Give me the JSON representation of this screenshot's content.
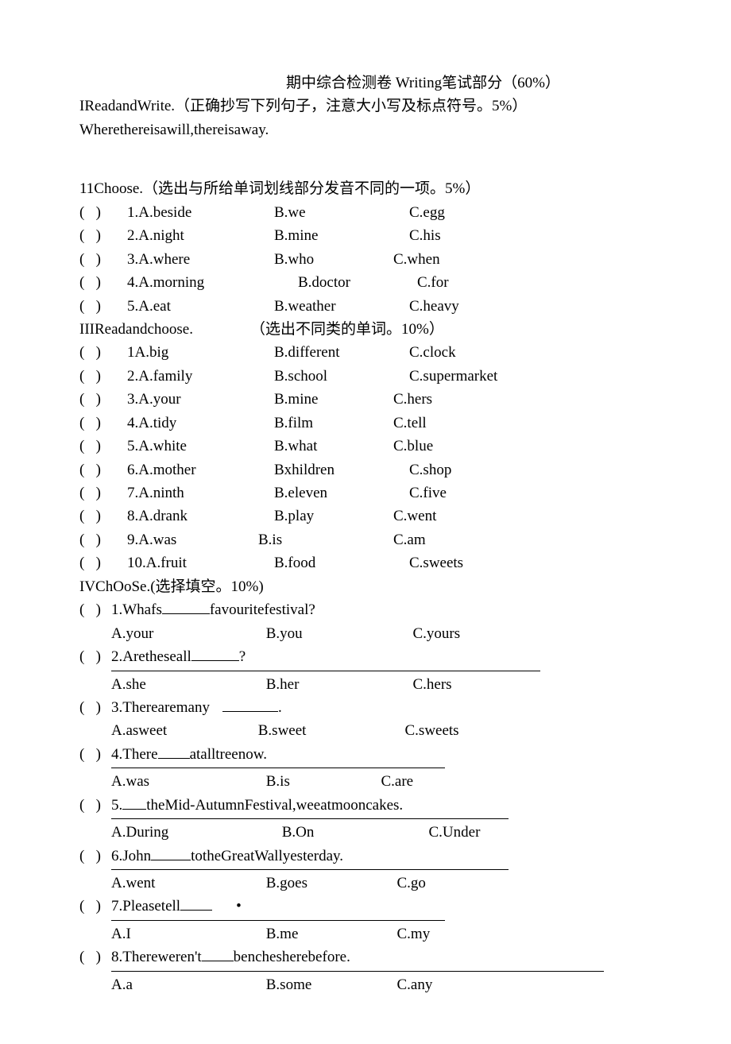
{
  "header": {
    "title": "期中综合检测卷 Writing笔试部分（60%）"
  },
  "section1": {
    "heading": "IReadandWrite.（正确抄写下列句子，注意大小写及标点符号。5%）",
    "sentence": "Wherethereisawill,thereisaway."
  },
  "section2": {
    "heading": "11Choose.（选出与所给单词划线部分发音不同的一项。5%）",
    "q": [
      {
        "n": "1",
        "a": "A.beside",
        "b": "B.we",
        "c": "C.egg"
      },
      {
        "n": "2",
        "a": "A.night",
        "b": "B.mine",
        "c": "C.his"
      },
      {
        "n": "3",
        "a": "A.where",
        "b": "B.who",
        "c": "C.when"
      },
      {
        "n": "4",
        "a": "A.morning",
        "b": "B.doctor",
        "c": "C.for"
      },
      {
        "n": "5",
        "a": "A.eat",
        "b": "B.weather",
        "c": "C.heavy"
      }
    ]
  },
  "section3": {
    "heading_left": "IIIReadandchoose.",
    "heading_right": "（选出不同类的单词。10%）",
    "q": [
      {
        "n": "1",
        "a": "A.big",
        "b": "B.different",
        "c": "C.clock"
      },
      {
        "n": "2",
        "a": "A.family",
        "b": "B.school",
        "c": "C.supermarket"
      },
      {
        "n": "3",
        "a": "A.your",
        "b": "B.mine",
        "c": "C.hers"
      },
      {
        "n": "4",
        "a": "A.tidy",
        "b": "B.film",
        "c": "C.tell"
      },
      {
        "n": "5",
        "a": "A.white",
        "b": "B.what",
        "c": "C.blue"
      },
      {
        "n": "6",
        "a": "A.mother",
        "b": "Bxhildren",
        "c": "C.shop"
      },
      {
        "n": "7",
        "a": "A.ninth",
        "b": "B.eleven",
        "c": "C.five"
      },
      {
        "n": "8",
        "a": "A.drank",
        "b": "B.play",
        "c": "C.went"
      },
      {
        "n": "9",
        "a": "A.was",
        "b": "B.is",
        "c": "C.am"
      },
      {
        "n": "10",
        "a": "A.fruit",
        "b": "B.food",
        "c": "C.sweets"
      }
    ]
  },
  "section4": {
    "heading": "IVChOoSe.(选择填空。10%)",
    "q1": {
      "stem_pre": "1.Whafs",
      "stem_post": "favouritefestival?",
      "a": "A.your",
      "b": "B.you",
      "c": "C.yours"
    },
    "q2": {
      "stem_pre": "2.Aretheseall",
      "stem_post": "?",
      "a": "A.she",
      "b": "B.her",
      "c": "C.hers"
    },
    "q3": {
      "stem_pre": "3.Therearemany",
      "stem_post": ".",
      "a": "A.asweet",
      "b": "B.sweet",
      "c": "C.sweets"
    },
    "q4": {
      "stem_pre": "4.There",
      "stem_post": "atalltreenow.",
      "a": "A.was",
      "b": "B.is",
      "c": "C.are"
    },
    "q5": {
      "stem_pre": "5.",
      "stem_post": "theMid-AutumnFestival,weeatmooncakes.",
      "a": "A.During",
      "b": "B.On",
      "c": "C.Under"
    },
    "q6": {
      "stem_pre": "6.John",
      "stem_post": "totheGreatWallyesterday.",
      "a": "A.went",
      "b": "B.goes",
      "c": "C.go"
    },
    "q7": {
      "stem_pre": "7.Pleasetell",
      "stem_dot": "•",
      "a": "A.I",
      "b": "B.me",
      "c": "C.my"
    },
    "q8": {
      "stem_pre": "8.Thereweren't",
      "stem_post": "bencheshere​before.",
      "a": "A.a",
      "b": "B.some",
      "c": "C.any"
    }
  },
  "paren": "(   )"
}
